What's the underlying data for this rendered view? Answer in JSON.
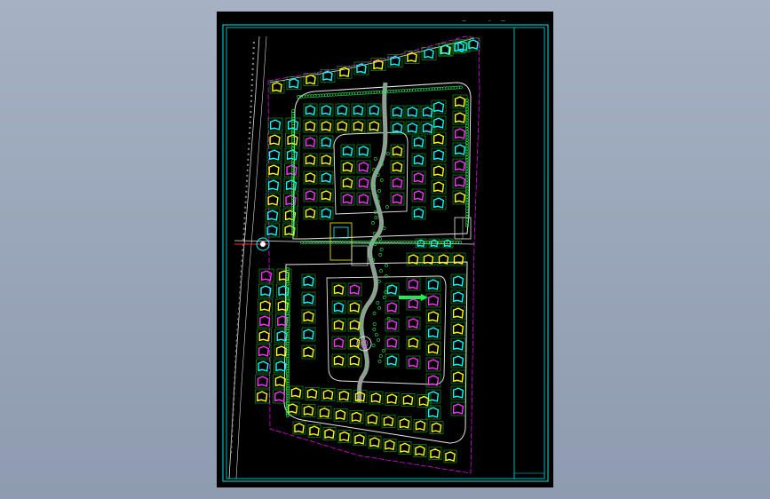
{
  "viewer": {
    "background_color": "#9aa7ba",
    "canvas_color": "#000000"
  },
  "drawing": {
    "frame_color": "#00e5e5",
    "road_color": "#e8e8e8",
    "lot_color": "#22cc22",
    "title_block_marks": [
      "——",
      "—",
      "——"
    ]
  },
  "palette": {
    "house_yellow": "#ffff00",
    "house_cyan": "#00ffff",
    "house_magenta": "#ff33ff",
    "tree_green": "#22ee55",
    "boundary_magenta": "#ff00ff",
    "marker_red": "#ff2a2a"
  }
}
